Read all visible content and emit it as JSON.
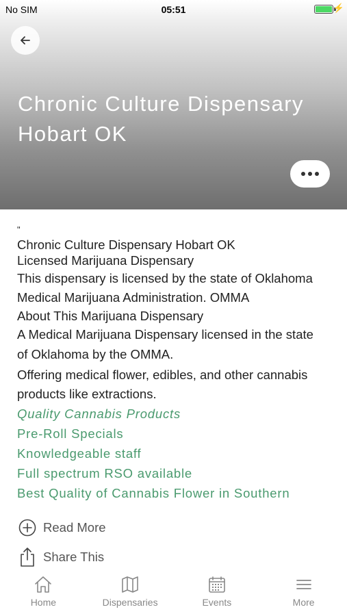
{
  "status_bar": {
    "carrier": "No SIM",
    "time": "05:51"
  },
  "header": {
    "title_line1": "Chronic Culture Dispensary",
    "title_line2": "Hobart OK"
  },
  "content": {
    "quote_mark": "\"",
    "lines": [
      "Chronic Culture Dispensary Hobart OK",
      "Licensed Marijuana Dispensary",
      "This dispensary is licensed by the state of Oklahoma",
      "Medical Marijuana Administration. OMMA",
      "About This Marijuana Dispensary",
      "A Medical Marijuana Dispensary licensed in the state",
      "of Oklahoma by the OMMA.",
      "Offering medical flower, edibles, and other cannabis",
      "products like extractions."
    ],
    "highlights": [
      "Quality Cannabis Products",
      "Pre-Roll Specials",
      "Knowledgeable staff",
      "Full spectrum RSO available",
      "Best Quality of Cannabis Flower in Southern"
    ]
  },
  "actions": {
    "read_more": "Read More",
    "share": "Share This"
  },
  "tabs": [
    {
      "label": "Home",
      "icon": "home-icon"
    },
    {
      "label": "Dispensaries",
      "icon": "map-icon"
    },
    {
      "label": "Events",
      "icon": "calendar-icon"
    },
    {
      "label": "More",
      "icon": "menu-icon"
    }
  ],
  "colors": {
    "accent_green": "#4a9a6e",
    "tab_gray": "#888888",
    "battery_green": "#4cd964"
  }
}
